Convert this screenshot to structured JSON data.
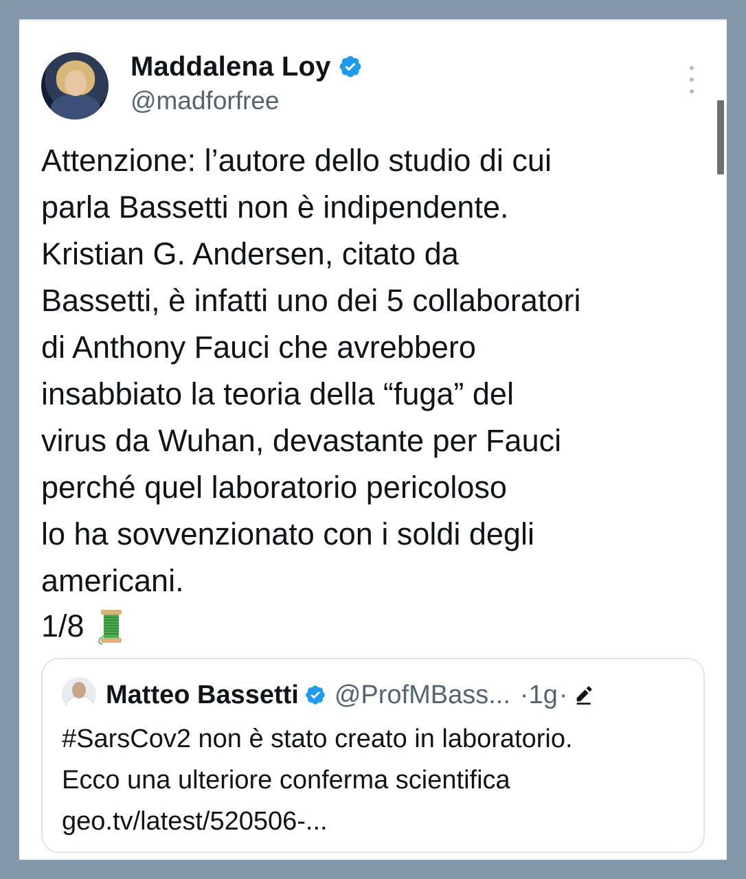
{
  "post": {
    "author": {
      "display_name": "Maddalena Loy",
      "handle": "@madforfree",
      "verified": true,
      "avatar_icon": "profile-photo"
    },
    "text": "Attenzione: l’autore dello studio di cui\nparla Bassetti non è indipendente.\nKristian G. Andersen, citato da\nBassetti, è infatti uno dei 5 collaboratori\ndi Anthony Fauci che avrebbero\ninsabbiato la teoria della “fuga” del\nvirus da Wuhan, devastante per Fauci\nperché quel laboratorio pericoloso\nlo ha sovvenzionato con i soldi degli\namericani.",
    "thread_counter": "1/8",
    "thread_emoji": "spool-of-thread-icon",
    "more_icon": "more-options-icon"
  },
  "quoted_post": {
    "author": {
      "display_name": "Matteo Bassetti",
      "handle": "@ProfMBass...",
      "verified": true
    },
    "separator": "·",
    "time": "1g",
    "separator2": "·",
    "edited_icon": "edit-pencil-icon",
    "text": "#SarsCov2 non è stato creato in laboratorio.\nEcco una ulteriore conferma scientifica\ngeo.tv/latest/520506-..."
  },
  "colors": {
    "background_frame": "#8597aa",
    "card": "#ffffff",
    "text_primary": "#0f1419",
    "text_secondary": "#536471",
    "verified_blue": "#1d9bf0"
  }
}
